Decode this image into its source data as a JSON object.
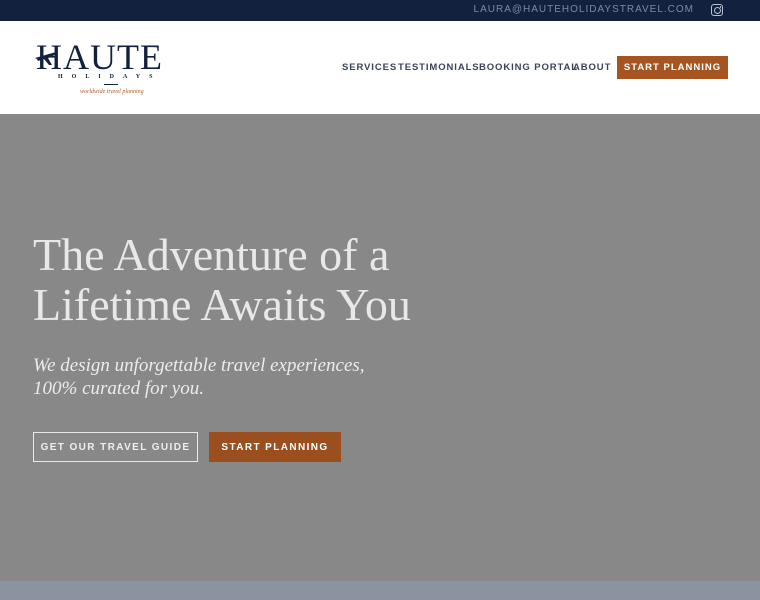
{
  "topbar": {
    "email": "LAURA@HAUTEHOLIDAYSTRAVEL.COM",
    "social_icon": "instagram-icon"
  },
  "logo": {
    "word": "HAUTE",
    "sub": "HOLIDAYS",
    "tagline": "worldwide travel planning"
  },
  "nav": {
    "items": [
      "SERVICES",
      "TESTIMONIALS",
      "BOOKING PORTAL",
      "ABOUT"
    ],
    "cta": "START PLANNING"
  },
  "hero": {
    "title": "The Adventure of a Lifetime Awaits You",
    "subtitle": "We design unforgettable travel experiences, 100% curated for you.",
    "guide_button": "GET OUR TRAVEL GUIDE",
    "start_button": "START PLANNING"
  },
  "colors": {
    "navy": "#12213d",
    "accent": "#a65520",
    "hero_bg": "#888888"
  }
}
